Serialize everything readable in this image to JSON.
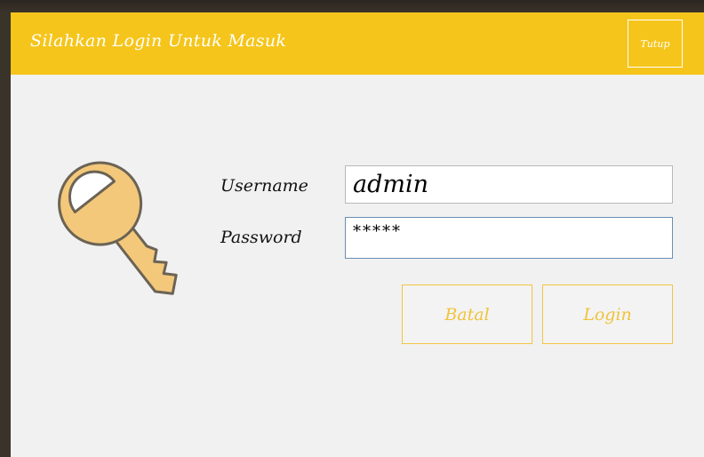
{
  "window": {
    "title": "Silahkan Login Untuk Masuk",
    "close_label": "Tutup"
  },
  "form": {
    "username_label": "Username",
    "username_value": "admin",
    "password_label": "Password",
    "password_value": "*****"
  },
  "buttons": {
    "cancel_label": "Batal",
    "login_label": "Login"
  },
  "icons": {
    "key": "key-icon"
  },
  "colors": {
    "titlebar": "#f5c51b",
    "accent": "#f0c33a",
    "key_fill": "#f4c87a",
    "key_outline": "#6b6355",
    "background": "#f1f1f1"
  }
}
